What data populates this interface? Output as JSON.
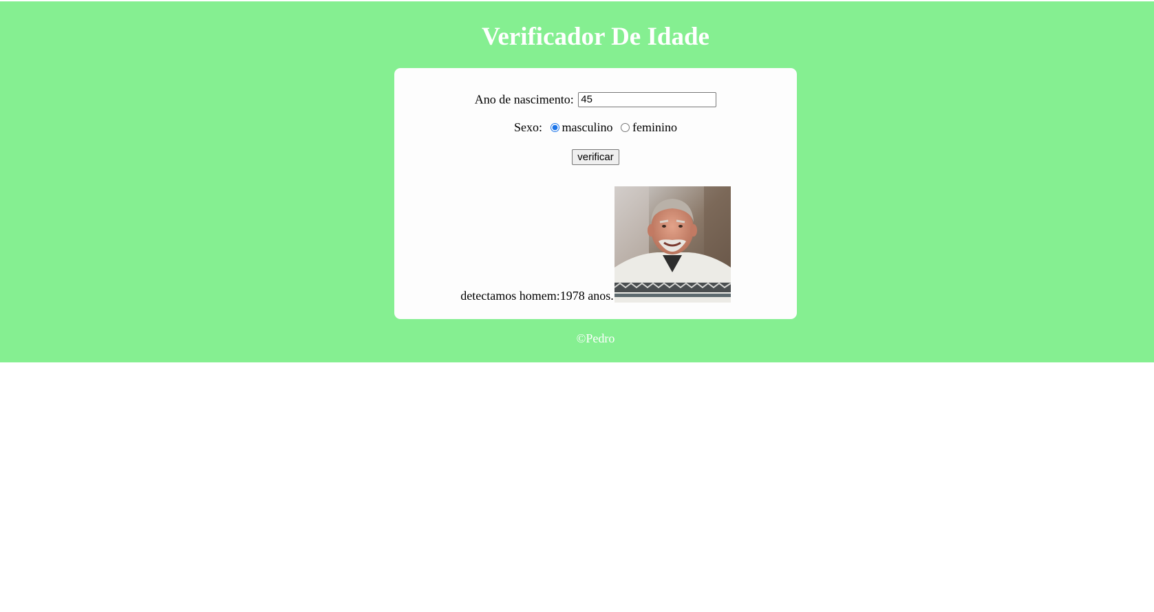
{
  "header": {
    "title": "Verificador De Idade"
  },
  "form": {
    "birth_year_label": "Ano de nascimento:",
    "birth_year_value": "45",
    "sex_label": "Sexo:",
    "sex_options": [
      "masculino",
      "feminino"
    ],
    "sex_selected": "masculino",
    "verify_button_label": "verificar"
  },
  "result": {
    "text": "detectamos homem:1978 anos.",
    "photo": "elderly-man-photo"
  },
  "footer": {
    "text": "©Pedro"
  },
  "colors": {
    "page_background": "#85ef91",
    "card_background": "#fdfdfd",
    "title_text": "#ffffff"
  }
}
